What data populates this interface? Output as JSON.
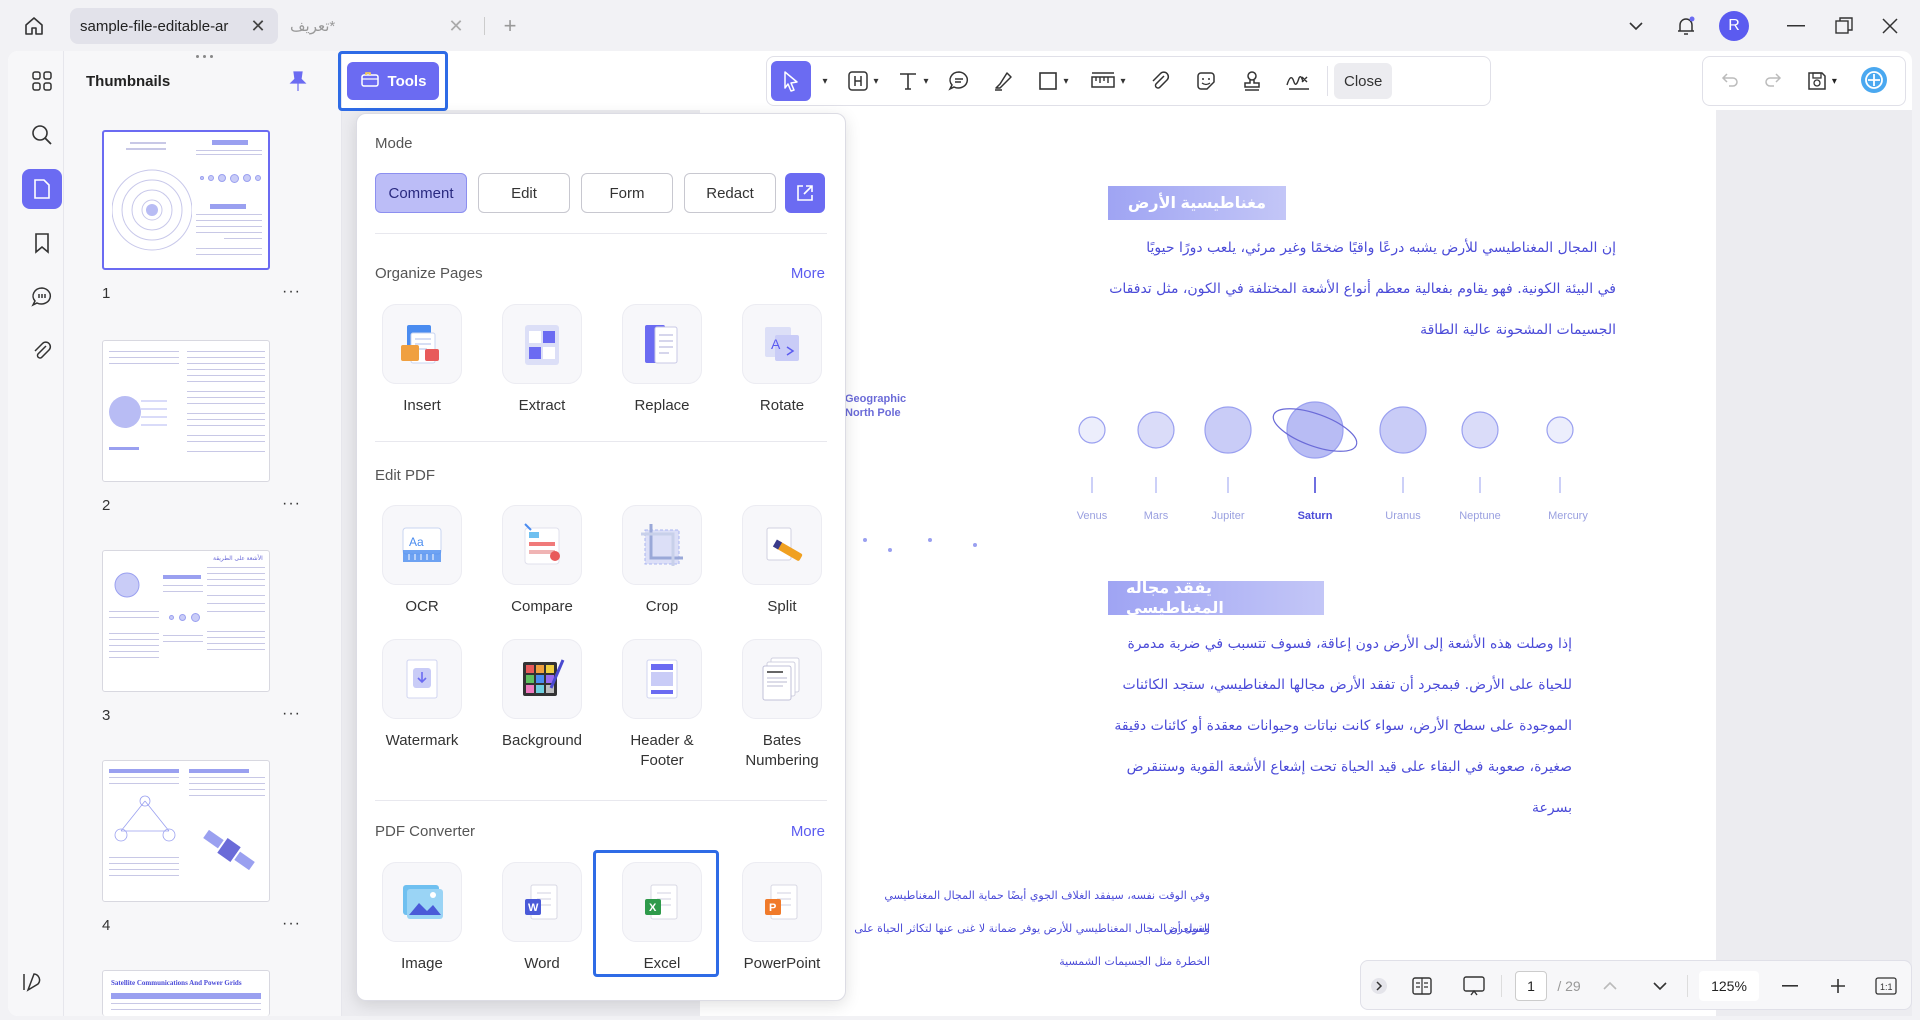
{
  "titlebar": {
    "active_tab": "sample-file-editable-ar",
    "inactive_tab": "تعريف*",
    "avatar_letter": "R"
  },
  "toolbar": {
    "tools_label": "Tools",
    "close_label": "Close"
  },
  "thumbnails": {
    "title": "Thumbnails",
    "pages": [
      "1",
      "2",
      "3",
      "4"
    ],
    "more": "···",
    "thumb4_title": "Satellite Communications And Power Grids",
    "thumb3_title": "الأشعة على الطريقة"
  },
  "panel": {
    "mode_title": "Mode",
    "modes": [
      "Comment",
      "Edit",
      "Form",
      "Redact"
    ],
    "organize_title": "Organize Pages",
    "edit_title": "Edit PDF",
    "converter_title": "PDF Converter",
    "more": "More",
    "organize": [
      "Insert",
      "Extract",
      "Replace",
      "Rotate"
    ],
    "edit_row1": [
      "OCR",
      "Compare",
      "Crop",
      "Split"
    ],
    "edit_row2": [
      "Watermark",
      "Background",
      "Header &\nFooter",
      "Bates\nNumbering"
    ],
    "converter": [
      "Image",
      "Word",
      "Excel",
      "PowerPoint"
    ]
  },
  "document": {
    "heading1": "مغناطيسية الأرض",
    "para1": [
      "إن المجال المغناطيسي للأرض يشبه درعًا واقيًا ضخمًا وغير مرئي، يلعب دورًا حيويًا",
      "في البيئة الكونية. فهو يقاوم بفعالية معظم أنواع الأشعة المختلفة في الكون، مثل تدفقات",
      "الجسيمات المشحونة عالية الطاقة"
    ],
    "pole_label": [
      "Geographic",
      "North Pole"
    ],
    "planets": [
      "Venus",
      "Mars",
      "Jupiter",
      "Saturn",
      "Uranus",
      "Neptune",
      "Mercury"
    ],
    "heading2": "يفقد مجاله المغناطيسي",
    "para2": [
      "إذا وصلت هذه الأشعة إلى الأرض دون إعاقة، فسوف تتسبب في ضربة مدمرة",
      "للحياة على الأرض. فبمجرد أن تفقد الأرض مجالها المغناطيسي، ستجد الكائنات",
      "الموجودة على سطح الأرض، سواء كانت نباتات وحيوانات معقدة أو كائنات دقيقة",
      "صغيرة، صعوبة في البقاء على قيد الحياة تحت إشعاع الأشعة القوية وستنقرض",
      "بسرعة"
    ],
    "para3": [
      "وفي الوقت نفسه، سيفقد الغلاف الجوي أيضًا حماية المجال المغناطيسي وسيتعرض",
      "القول أن المجال المغناطيسي للأرض يوفر ضمانة لا غنى عنها لتكاثر الحياة على",
      "الخطرة مثل الجسيمات الشمسية"
    ]
  },
  "bottom": {
    "page": "1",
    "total": "/ 29",
    "zoom": "125%"
  },
  "colors": {
    "accent": "#6b6bf2",
    "highlight": "#2e6be6",
    "arabic_text": "#4b4bd8"
  }
}
